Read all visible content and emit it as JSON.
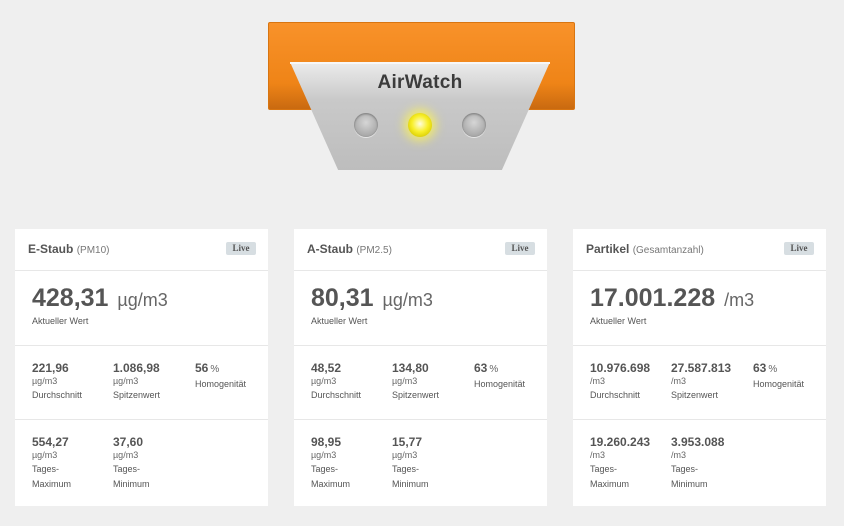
{
  "header": {
    "brand": "AirWatch"
  },
  "cards": [
    {
      "title": "E-Staub",
      "subtitle": "(PM10)",
      "live": "Live",
      "main": {
        "value": "428,31",
        "unit": "µg/m3",
        "label": "Aktueller Wert"
      },
      "stats": [
        {
          "value": "221,96",
          "unit": "µg/m3",
          "label": "Durchschnitt"
        },
        {
          "value": "1.086,98",
          "unit": "µg/m3",
          "label": "Spitzenwert"
        },
        {
          "value": "56",
          "unit": "%",
          "label": "Homogenität"
        }
      ],
      "daily": [
        {
          "value": "554,27",
          "unit": "µg/m3",
          "label1": "Tages-",
          "label2": "Maximum"
        },
        {
          "value": "37,60",
          "unit": "µg/m3",
          "label1": "Tages-",
          "label2": "Minimum"
        }
      ]
    },
    {
      "title": "A-Staub",
      "subtitle": "(PM2.5)",
      "live": "Live",
      "main": {
        "value": "80,31",
        "unit": "µg/m3",
        "label": "Aktueller Wert"
      },
      "stats": [
        {
          "value": "48,52",
          "unit": "µg/m3",
          "label": "Durchschnitt"
        },
        {
          "value": "134,80",
          "unit": "µg/m3",
          "label": "Spitzenwert"
        },
        {
          "value": "63",
          "unit": "%",
          "label": "Homogenität"
        }
      ],
      "daily": [
        {
          "value": "98,95",
          "unit": "µg/m3",
          "label1": "Tages-",
          "label2": "Maximum"
        },
        {
          "value": "15,77",
          "unit": "µg/m3",
          "label1": "Tages-",
          "label2": "Minimum"
        }
      ]
    },
    {
      "title": "Partikel",
      "subtitle": "(Gesamtanzahl)",
      "live": "Live",
      "main": {
        "value": "17.001.228",
        "unit": "/m3",
        "label": "Aktueller Wert"
      },
      "stats": [
        {
          "value": "10.976.698",
          "unit": "/m3",
          "label": "Durchschnitt"
        },
        {
          "value": "27.587.813",
          "unit": "/m3",
          "label": "Spitzenwert"
        },
        {
          "value": "63",
          "unit": "%",
          "label": "Homogenität"
        }
      ],
      "daily": [
        {
          "value": "19.260.243",
          "unit": "/m3",
          "label1": "Tages-",
          "label2": "Maximum"
        },
        {
          "value": "3.953.088",
          "unit": "/m3",
          "label1": "Tages-",
          "label2": "Minimum"
        }
      ]
    }
  ],
  "indicator_lights": [
    {
      "name": "left-light",
      "state": "off"
    },
    {
      "name": "center-light",
      "state": "on",
      "color": "#f8ef2a"
    },
    {
      "name": "right-light",
      "state": "off"
    }
  ],
  "colors": {
    "accent": "#f39020",
    "background": "#efefef",
    "card": "#ffffff",
    "live_badge": "#d7dee2"
  }
}
